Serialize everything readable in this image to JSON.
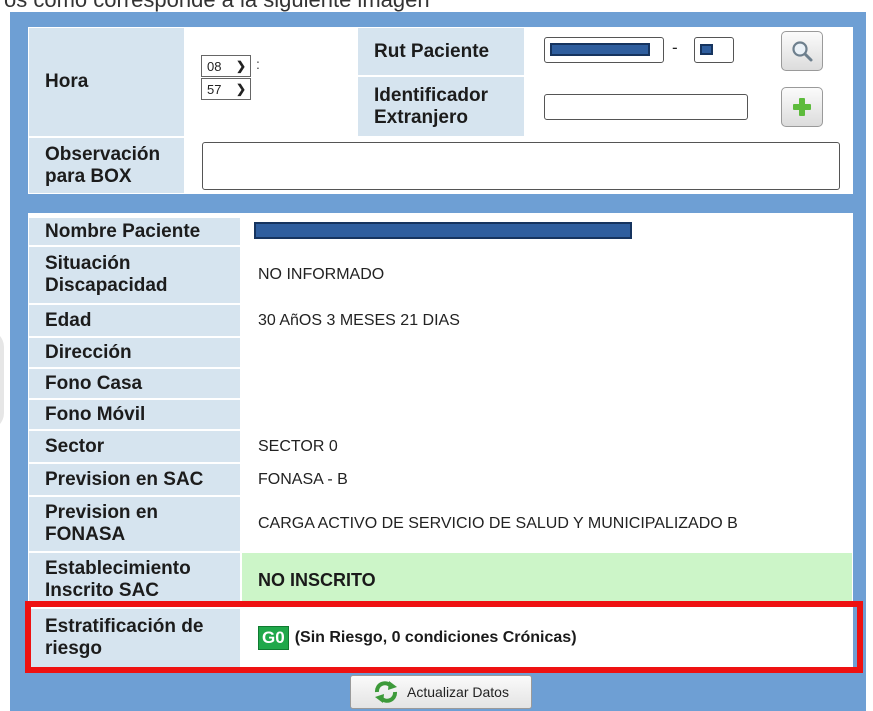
{
  "top_caption": "os como corresponde a la siguiente imagen",
  "form": {
    "hora_label": "Hora",
    "hour_value": "08",
    "minute_value": "57",
    "time_separator": ":",
    "rut_label": "Rut Paciente",
    "rut_separator": "-",
    "foreign_id_label": "Identificador Extranjero",
    "foreign_id_value": "",
    "observation_label": "Observación para BOX",
    "observation_value": ""
  },
  "patient": {
    "name_label": "Nombre Paciente",
    "rows": [
      {
        "label": "Situación Discapacidad",
        "value": "NO INFORMADO"
      },
      {
        "label": "Edad",
        "value": "30 AñOS 3 MESES 21 DIAS"
      },
      {
        "label": "Dirección",
        "value": ""
      },
      {
        "label": "Fono Casa",
        "value": ""
      },
      {
        "label": "Fono Móvil",
        "value": ""
      },
      {
        "label": "Sector",
        "value": "SECTOR 0"
      },
      {
        "label": "Prevision en SAC",
        "value": "FONASA - B"
      },
      {
        "label": "Prevision en FONASA",
        "value": "CARGA ACTIVO DE SERVICIO DE SALUD Y MUNICIPALIZADO B"
      },
      {
        "label": "Establecimiento Inscrito SAC",
        "value": "NO INSCRITO"
      }
    ],
    "risk_label": "Estratificación de riesgo",
    "risk_badge": "G0",
    "risk_text": "(Sin Riesgo, 0 condiciones Crónicas)"
  },
  "update_button_label": "Actualizar Datos",
  "colors": {
    "panel_blue": "#6e9fd4",
    "label_bg": "#d6e4ef",
    "highlight_red": "#ee1111",
    "inscrito_green": "#ccf5c8",
    "badge_green": "#1fa84a"
  },
  "icons": {
    "search": "magnifier-icon",
    "add": "plus-icon",
    "update": "refresh-icon"
  }
}
